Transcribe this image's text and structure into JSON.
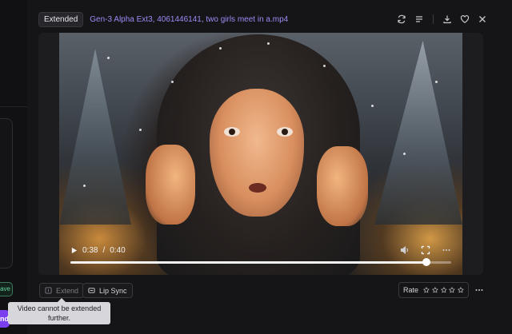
{
  "left_panel": {
    "save_label": "ave",
    "primary_label": "nd"
  },
  "header": {
    "badge": "Extended",
    "title": "Gen-3 Alpha Ext3, 4061446141, two girls meet in a.mp4",
    "icons": [
      "refresh-icon",
      "list-icon",
      "download-icon",
      "heart-icon",
      "close-icon"
    ]
  },
  "player": {
    "current_time": "0:38",
    "separator": "/",
    "duration": "0:40",
    "progress": 0.935
  },
  "toolbar": {
    "extend_label": "Extend",
    "lipsync_label": "Lip Sync",
    "rate_label": "Rate",
    "star_count": 5
  },
  "tooltip": {
    "text": "Video cannot be extended further."
  },
  "colors": {
    "title_accent": "#9b8cf6",
    "save_green": "#62d39d",
    "primary_purple": "#7b3ff2"
  }
}
